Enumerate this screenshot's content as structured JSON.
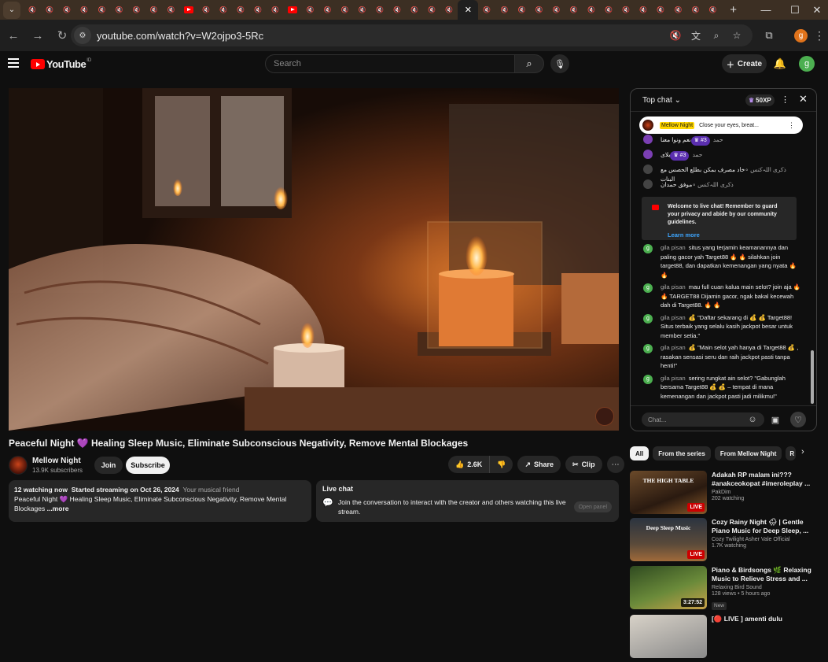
{
  "browser": {
    "url": "youtube.com/watch?v=W2ojpo3-5Rc",
    "profile_letter": "g",
    "tab_count_icons": [
      "mute-tab",
      "mute-tab",
      "mute-tab",
      "mute-tab",
      "mute-tab",
      "mute-tab",
      "mute-tab",
      "mute-tab",
      "mute-tab",
      "youtube-tab",
      "mute-tab",
      "mute-tab",
      "mute-tab",
      "mute-tab",
      "mute-tab",
      "youtube-tab",
      "mute-tab",
      "mute-tab",
      "mute-tab",
      "mute-tab",
      "mute-tab",
      "mute-tab",
      "mute-tab",
      "mute-tab",
      "mute-tab",
      "active-tab",
      "mute-tab",
      "mute-tab",
      "mute-tab",
      "mute-tab",
      "mute-tab",
      "mute-tab",
      "mute-tab",
      "mute-tab",
      "mute-tab",
      "mute-tab",
      "mute-tab",
      "mute-tab",
      "mute-tab",
      "mute-tab"
    ]
  },
  "yt_header": {
    "logo_text": "YouTube",
    "region": "ID",
    "search_placeholder": "Search",
    "create_label": "Create",
    "avatar_letter": "g"
  },
  "video": {
    "title": "Peaceful Night 💜 Healing Sleep Music, Eliminate Subconscious Negativity, Remove Mental Blockages",
    "channel": "Mellow Night",
    "subscribers": "13.9K subscribers",
    "join_label": "Join",
    "subscribe_label": "Subscribe",
    "likes": "2.6K",
    "share_label": "Share",
    "clip_label": "Clip"
  },
  "description": {
    "watching": "12",
    "watching_suffix": " watching now",
    "started": "Started streaming on Oct 26, 2024",
    "tagline": "Your musical friend",
    "text": "Peaceful Night 💜 Healing Sleep Music, Eliminate Subconscious Negativity, Remove Mental Blockages",
    "more": "...more"
  },
  "live_chat_box": {
    "title": "Live chat",
    "text": "Join the conversation to interact with the creator and others watching this live stream.",
    "open_panel": "Open panel"
  },
  "chat": {
    "mode": "Top chat",
    "xp": "50XP",
    "pinned_author": "Mellow Night",
    "pinned_text": "Close your eyes, breat...",
    "input_placeholder": "Chat...",
    "top_messages": [
      {
        "author": "حمد",
        "badge": "#3",
        "text": "نعم ونوا معنا"
      },
      {
        "author": "حمد",
        "badge": "#3",
        "text": "بلای"
      },
      {
        "author": "ذکری اللہ‌کنس ∘",
        "badge": "",
        "text": "خاد مصرف بمکن بطلع الحصس مع البنات"
      },
      {
        "author": "ذکری اللہ‌کنس ∘",
        "badge": "",
        "text": "موفق حمدان"
      }
    ],
    "welcome_text": "Welcome to live chat! Remember to guard your privacy and abide by our community guidelines.",
    "welcome_link": "Learn more",
    "messages": [
      {
        "author": "gila pisan",
        "text": "situs yang terjamin keamanannya dan paling gacor yah Target88 🔥 🔥 silahkan join target88, dan dapatkan kemenangan yang nyata 🔥 🔥"
      },
      {
        "author": "gila pisan",
        "text": "mau full cuan kalua main selot? join aja 🔥 🔥 TARGET88 Dijamin gacor, ngak bakal kecewah dah di Target88. 🔥 🔥"
      },
      {
        "author": "gila pisan",
        "text": "💰 \"Daftar sekarang di 💰 💰 Target88! Situs terbaik yang selalu kasih jackpot besar untuk member setia.\""
      },
      {
        "author": "gila pisan",
        "text": "💰 \"Main selot yah hanya di Target88 💰 , rasakan sensasi seru dan raih jackpot pasti tanpa henti!\""
      },
      {
        "author": "gila pisan",
        "text": "sering rungkat ain selot? \"Gabunglah bersama Target88 💰 💰 – tempat di mana kemenangan dan jackpot pasti jadi milikmu!\""
      }
    ]
  },
  "chips": [
    "All",
    "From the series",
    "From Mellow Night",
    "R"
  ],
  "recommendations": [
    {
      "title": "Adakah RP  malam ini??? #anakceokopat #imeroleplay ...",
      "channel": "PakDim",
      "meta": "202 watching",
      "badge": "LIVE",
      "thumb_text": "THE HIGH TABLE",
      "new": ""
    },
    {
      "title": "Cozy Rainy Night 🌧 | Gentle Piano Music for Deep Sleep, ...",
      "channel": "Cozy Twilight Asher Vale Official",
      "meta": "1.7K watching",
      "badge": "LIVE",
      "thumb_text": "Deep Sleep Music",
      "new": ""
    },
    {
      "title": "Piano & Birdsongs 🌿  Relaxing Music to Relieve Stress and ...",
      "channel": "Relaxing Bird Sound",
      "meta": "128 views • 5 hours ago",
      "badge": "3:27:52",
      "thumb_text": "",
      "new": "New"
    },
    {
      "title": "[🔴 LIVE ] amenti dulu",
      "channel": "",
      "meta": "",
      "badge": "",
      "thumb_text": "",
      "new": ""
    }
  ],
  "colors": {
    "accent": "#ff0000",
    "link": "#3ea6ff",
    "tabbar": "#3c2f23",
    "background": "#0f0f0f"
  }
}
